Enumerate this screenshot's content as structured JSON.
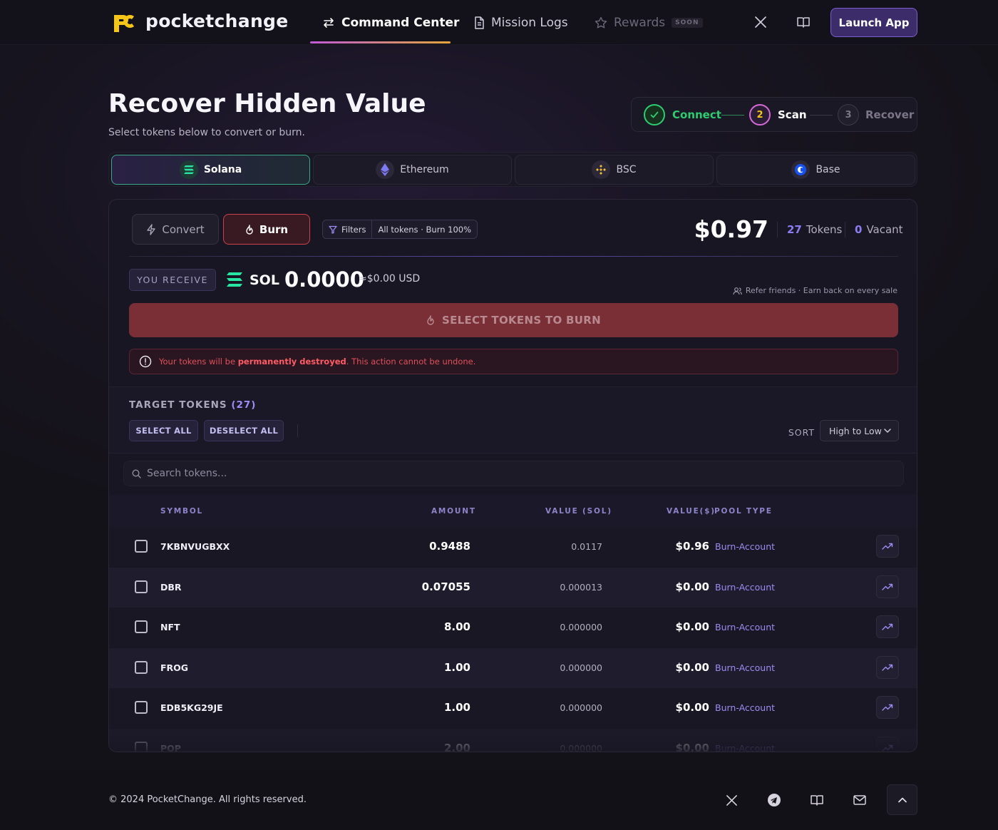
{
  "header": {
    "brand": "pocketchange",
    "nav": {
      "command_center": "Command Center",
      "mission_logs": "Mission Logs",
      "rewards": "Rewards",
      "rewards_badge": "SOON"
    },
    "launch_label": "Launch App"
  },
  "page": {
    "title": "Recover Hidden Value",
    "subtitle": "Select tokens below to convert or burn."
  },
  "stepper": {
    "steps": [
      {
        "number": "1",
        "label": "Connect",
        "state": "done"
      },
      {
        "number": "2",
        "label": "Scan",
        "state": "active"
      },
      {
        "number": "3",
        "label": "Recover",
        "state": "pending"
      }
    ]
  },
  "chains": [
    {
      "label": "Solana",
      "active": true
    },
    {
      "label": "Ethereum",
      "active": false
    },
    {
      "label": "BSC",
      "active": false
    },
    {
      "label": "Base",
      "active": false
    }
  ],
  "panel": {
    "convert_label": "Convert",
    "burn_label": "Burn",
    "filters_label": "Filters",
    "filters_value": "All tokens · Burn 100%",
    "total_value": "$0.97",
    "tokens_count": "27",
    "tokens_label": "Tokens",
    "vacant_count": "0",
    "vacant_label": "Vacant",
    "receive_label": "YOU RECEIVE",
    "receive_currency": "SOL",
    "receive_amount": "0.0000",
    "receive_usd": "≈$0.00 USD",
    "refer_text": "Refer friends · Earn back on every sale",
    "action_label": "SELECT TOKENS TO BURN",
    "warning_prefix": "Your tokens will be",
    "warning_strong": "permanently destroyed",
    "warning_suffix": ". This action cannot be undone."
  },
  "targets": {
    "title": "TARGET TOKENS",
    "count": "(27)",
    "select_all": "SELECT ALL",
    "deselect_all": "DESELECT ALL",
    "sort_label": "SORT",
    "sort_value": "High to Low",
    "search_placeholder": "Search tokens..."
  },
  "table": {
    "columns": {
      "symbol": "SYMBOL",
      "amount": "AMOUNT",
      "value_sol": "VALUE (SOL)",
      "value_usd": "VALUE($)",
      "pool_type": "POOL TYPE"
    },
    "rows": [
      {
        "symbol": "7KBNVUGBXX",
        "amount": "0.9488",
        "value_sol": "0.0117",
        "value_usd": "$0.96",
        "pool": "Burn-Account"
      },
      {
        "symbol": "DBR",
        "amount": "0.07055",
        "value_sol": "0.000013",
        "value_usd": "$0.00",
        "pool": "Burn-Account"
      },
      {
        "symbol": "NFT",
        "amount": "8.00",
        "value_sol": "0.000000",
        "value_usd": "$0.00",
        "pool": "Burn-Account"
      },
      {
        "symbol": "FROG",
        "amount": "1.00",
        "value_sol": "0.000000",
        "value_usd": "$0.00",
        "pool": "Burn-Account"
      },
      {
        "symbol": "EDB5KG29JE",
        "amount": "1.00",
        "value_sol": "0.000000",
        "value_usd": "$0.00",
        "pool": "Burn-Account"
      },
      {
        "symbol": "POP",
        "amount": "2.00",
        "value_sol": "0.000000",
        "value_usd": "$0.00",
        "pool": "Burn-Account"
      }
    ]
  },
  "footer": {
    "copyright": "© 2024 PocketChange. All rights reserved."
  },
  "colors": {
    "accent_purple": "#7b5ed0",
    "burn_red": "#c9434d",
    "success_green": "#2ecc71",
    "brand_yellow": "#f5c518"
  }
}
